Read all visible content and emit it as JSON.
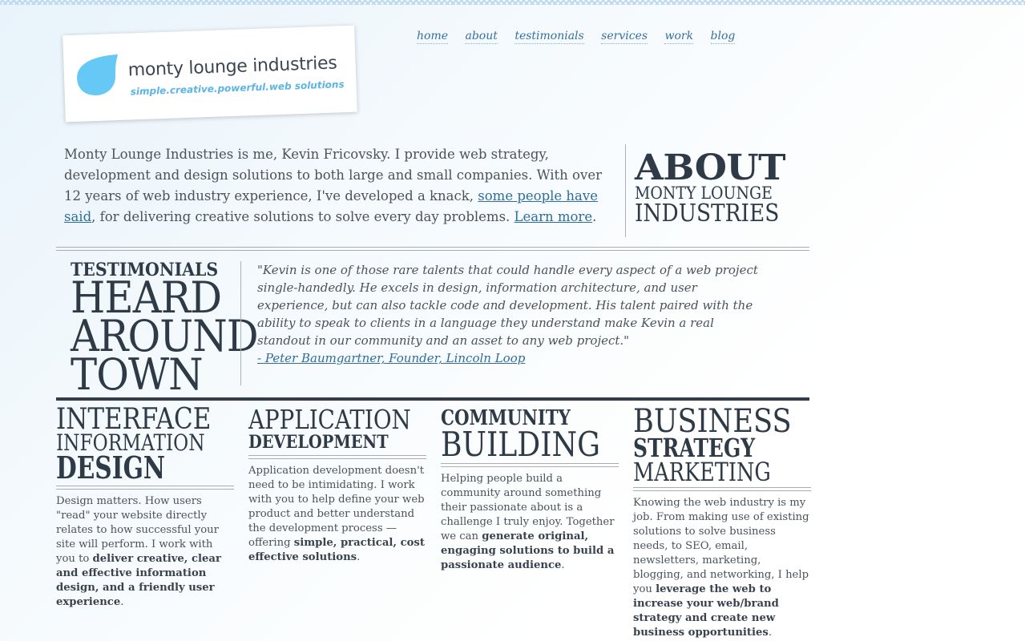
{
  "logo": {
    "title": "monty lounge industries",
    "tagline": "simple.creative.powerful.web solutions",
    "drop_color": "#66c8f5"
  },
  "nav": {
    "items": [
      "home",
      "about",
      "testimonials",
      "services",
      "work",
      "blog"
    ]
  },
  "about": {
    "text_before_link": "Monty Lounge Industries is me, Kevin Fricovsky. I provide web strategy, development and design solutions to both large and small companies. With over 12 years of web industry experience, I've developed a knack, ",
    "link1": "some people have said",
    "text_middle": ", for delivering creative solutions to solve every day problems. ",
    "link2": "Learn more",
    "text_end": ".",
    "heading_line1": "ABOUT",
    "heading_line2": "MONTY LOUNGE",
    "heading_line3": "INDUSTRIES"
  },
  "testimonials": {
    "heading_small": "TESTIMONIALS",
    "heading_line1": "HEARD",
    "heading_line2": "AROUND",
    "heading_line3": "TOWN",
    "quote": "\"Kevin is one of those rare talents that could handle every aspect of a web project single-handedly. He excels in design, information architecture, and user experience, but can also tackle code and development. His talent paired with the ability to speak to clients in a language they understand make Kevin a real standout in our community and an asset to any web project.\"",
    "author": "- Peter Baumgartner, Founder, Lincoln Loop"
  },
  "services": [
    {
      "title_lines": [
        "INTERFACE",
        "INFORMATION",
        "DESIGN"
      ],
      "body_plain": "Design matters. How users \"read\" your website directly relates to how successful your site will perform. I work with you to ",
      "body_bold": "deliver creative, clear and effective information design, and a friendly user experience",
      "body_end": "."
    },
    {
      "title_lines": [
        "APPLICATION",
        "DEVELOPMENT"
      ],
      "body_plain": "Application development doesn't need to be intimidating. I work with you to help define your web product and better understand the development process — offering ",
      "body_bold": "simple, practical, cost effective solutions",
      "body_end": "."
    },
    {
      "title_lines": [
        "COMMUNITY",
        "BUILDING"
      ],
      "body_plain": "Helping people build a community around something their passionate about is a challenge I truly enjoy. Together we can ",
      "body_bold": "generate original, engaging solutions to build a passionate audience",
      "body_end": "."
    },
    {
      "title_lines": [
        "BUSINESS",
        "STRATEGY",
        "MARKETING"
      ],
      "body_plain": "Knowing the web industry is my job. From making use of existing solutions to solve business needs, to SEO, email, newsletters, marketing, blogging, and networking, I help you ",
      "body_bold": "leverage the web to increase your web/brand strategy and create new business opportunities",
      "body_end": "."
    }
  ]
}
